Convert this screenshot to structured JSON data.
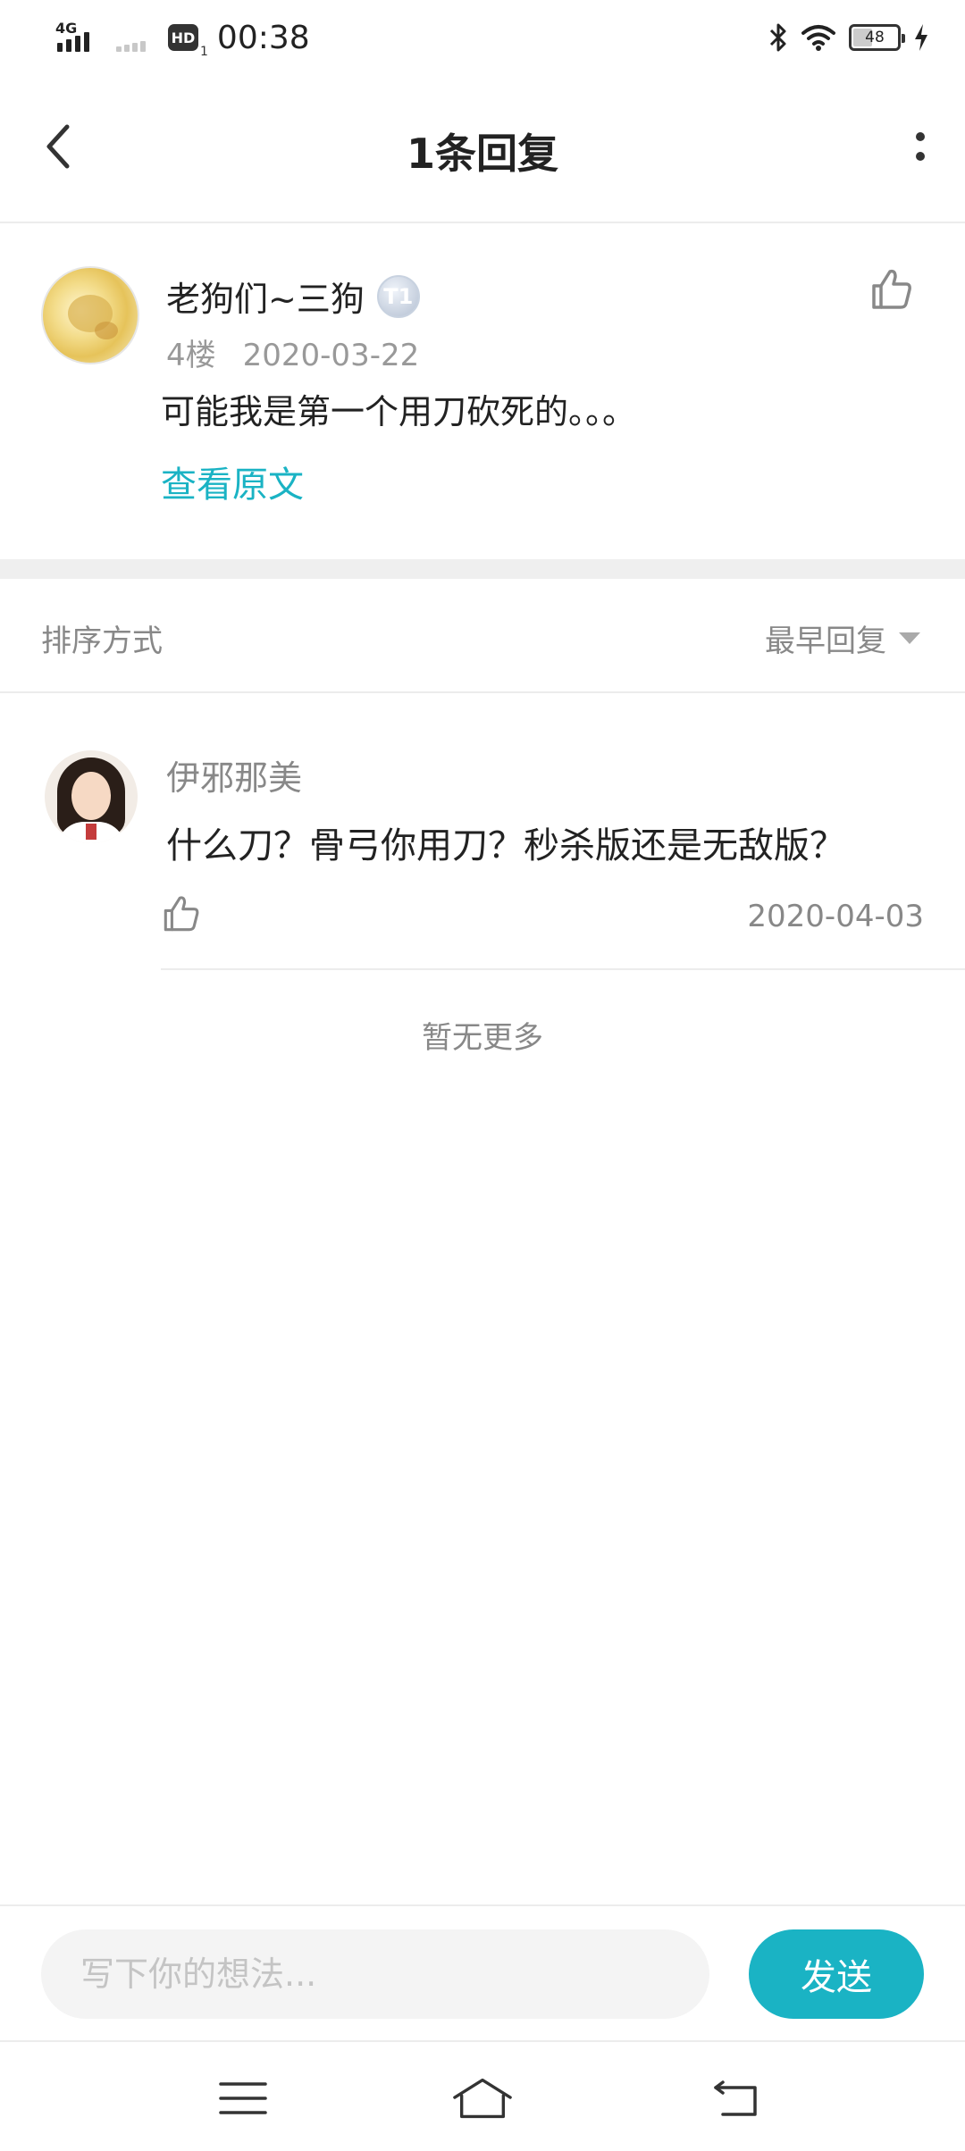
{
  "status_bar": {
    "network_label": "4G",
    "hd_label": "HD",
    "hd_sub": "1",
    "time": "00:38",
    "battery_level": "48"
  },
  "nav": {
    "title": "1条回复",
    "back_icon": "chevron-left-icon",
    "more_icon": "vertical-dots-icon"
  },
  "post": {
    "username": "老狗们~三狗",
    "level_badge": "T1",
    "floor": "4楼",
    "date": "2020-03-22",
    "content": "可能我是第一个用刀砍死的。。。",
    "view_original": "查看原文",
    "like_icon": "thumbs-up-icon"
  },
  "sort": {
    "label": "排序方式",
    "selected": "最早回复"
  },
  "replies": [
    {
      "username": "伊邪那美",
      "content": "什么刀？骨弓你用刀？秒杀版还是无敌版？",
      "date": "2020-04-03",
      "like_icon": "thumbs-up-icon"
    }
  ],
  "footer_note": "暂无更多",
  "composer": {
    "placeholder": "写下你的想法...",
    "send_label": "发送"
  },
  "colors": {
    "accent": "#1ab3c4",
    "text_primary": "#222222",
    "text_secondary": "#888888",
    "divider": "#ececec"
  },
  "system_nav": {
    "menu_icon": "menu-icon",
    "home_icon": "home-icon",
    "back_icon": "back-arrow-icon"
  }
}
